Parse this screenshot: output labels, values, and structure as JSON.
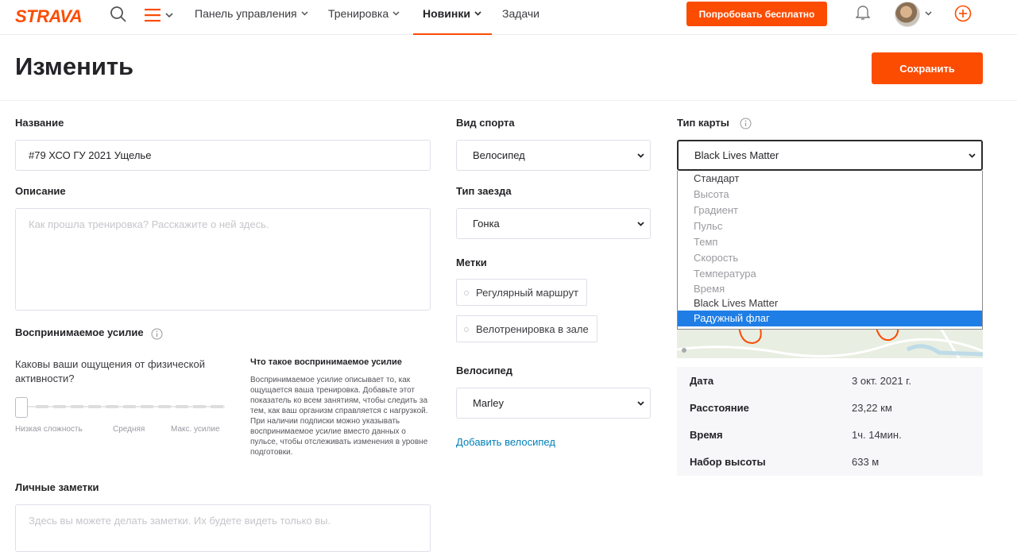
{
  "brand": {
    "name": "STRAVA",
    "accent": "#fc4c02"
  },
  "nav": {
    "items": [
      {
        "label": "Панель управления",
        "has_chevron": true
      },
      {
        "label": "Тренировка",
        "has_chevron": true
      },
      {
        "label": "Новинки",
        "has_chevron": true,
        "active": true
      },
      {
        "label": "Задачи",
        "has_chevron": false
      }
    ],
    "try_free_label": "Попробовать бесплатно",
    "icons": [
      "search-icon",
      "hamburger-icon",
      "bell-icon",
      "avatar",
      "add-circle-icon"
    ]
  },
  "header": {
    "title": "Изменить",
    "save_label": "Сохранить"
  },
  "form": {
    "name_label": "Название",
    "name_value": "#79 ХСО ГУ 2021 Ущелье",
    "description_label": "Описание",
    "description_placeholder": "Как прошла тренировка? Расскажите о ней здесь.",
    "perceived_label": "Воспринимаемое усилие",
    "perceived_question": "Каковы ваши ощущения от физической активности?",
    "scale_labels": [
      "Низкая сложность",
      "Средняя",
      "Макс. усилие"
    ],
    "perceived_value": 0,
    "info_title": "Что такое воспринимаемое усилие",
    "info_text": "Воспринимаемое усилие описывает то, как ощущается ваша тренировка. Добавьте этот показатель ко всем занятиям, чтобы следить за тем, как ваш организм справляется с нагрузкой. При наличии подписки можно указывать воспринимаемое усилие вместо данных о пульсе, чтобы отслеживать изменения в уровне подготовки.",
    "private_notes_label": "Личные заметки",
    "private_notes_placeholder": "Здесь вы можете делать заметки. Их будете видеть только вы.",
    "sport_label": "Вид спорта",
    "sport_value": "Велосипед",
    "ride_type_label": "Тип заезда",
    "ride_type_value": "Гонка",
    "tags_label": "Метки",
    "tags": [
      "Регулярный маршрут",
      "Велотренировка в зале"
    ],
    "bike_label": "Велосипед",
    "bike_value": "Marley",
    "add_bike_label": "Добавить велосипед",
    "map_type_label": "Тип карты",
    "map_type_value": "Black Lives Matter",
    "map_type_options": [
      "Стандарт",
      "Высота",
      "Градиент",
      "Пульс",
      "Темп",
      "Скорость",
      "Температура",
      "Время",
      "Black Lives Matter",
      "Радужный флаг"
    ],
    "map_type_highlighted": "Радужный флаг"
  },
  "stats": [
    {
      "label": "Дата",
      "value": "3 окт. 2021 г."
    },
    {
      "label": "Расстояние",
      "value": "23,22 км"
    },
    {
      "label": "Время",
      "value": "1ч. 14мин."
    },
    {
      "label": "Набор высоты",
      "value": "633 м"
    }
  ]
}
